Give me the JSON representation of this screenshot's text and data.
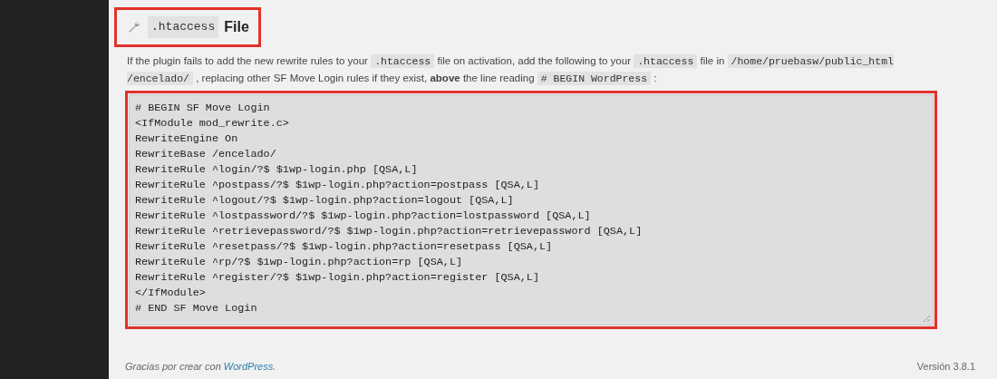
{
  "heading": {
    "code": ".htaccess",
    "text": "File"
  },
  "instructions": [
    {
      "kind": "text",
      "text": "If the plugin fails to add the new rewrite rules to your "
    },
    {
      "kind": "code",
      "text": ".htaccess"
    },
    {
      "kind": "text",
      "text": " file on activation, add the following to your "
    },
    {
      "kind": "code",
      "text": ".htaccess"
    },
    {
      "kind": "text",
      "text": " file in "
    },
    {
      "kind": "code",
      "text": "/home/pruebasw/public_html /encelado/"
    },
    {
      "kind": "text",
      "text": " , replacing other SF Move Login rules if they exist, "
    },
    {
      "kind": "bold",
      "text": "above"
    },
    {
      "kind": "text",
      "text": " the line reading "
    },
    {
      "kind": "code",
      "text": "# BEGIN WordPress"
    },
    {
      "kind": "text",
      "text": " :"
    }
  ],
  "rules": [
    "# BEGIN SF Move Login",
    "<IfModule mod_rewrite.c>",
    "RewriteEngine On",
    "RewriteBase /encelado/",
    "RewriteRule ^login/?$ $1wp-login.php [QSA,L]",
    "RewriteRule ^postpass/?$ $1wp-login.php?action=postpass [QSA,L]",
    "RewriteRule ^logout/?$ $1wp-login.php?action=logout [QSA,L]",
    "RewriteRule ^lostpassword/?$ $1wp-login.php?action=lostpassword [QSA,L]",
    "RewriteRule ^retrievepassword/?$ $1wp-login.php?action=retrievepassword [QSA,L]",
    "RewriteRule ^resetpass/?$ $1wp-login.php?action=resetpass [QSA,L]",
    "RewriteRule ^rp/?$ $1wp-login.php?action=rp [QSA,L]",
    "RewriteRule ^register/?$ $1wp-login.php?action=register [QSA,L]",
    "</IfModule>",
    "# END SF Move Login"
  ],
  "footer": {
    "text": "Gracias por crear con ",
    "link": "WordPress",
    "after": ".",
    "version": "Versión 3.8.1"
  }
}
